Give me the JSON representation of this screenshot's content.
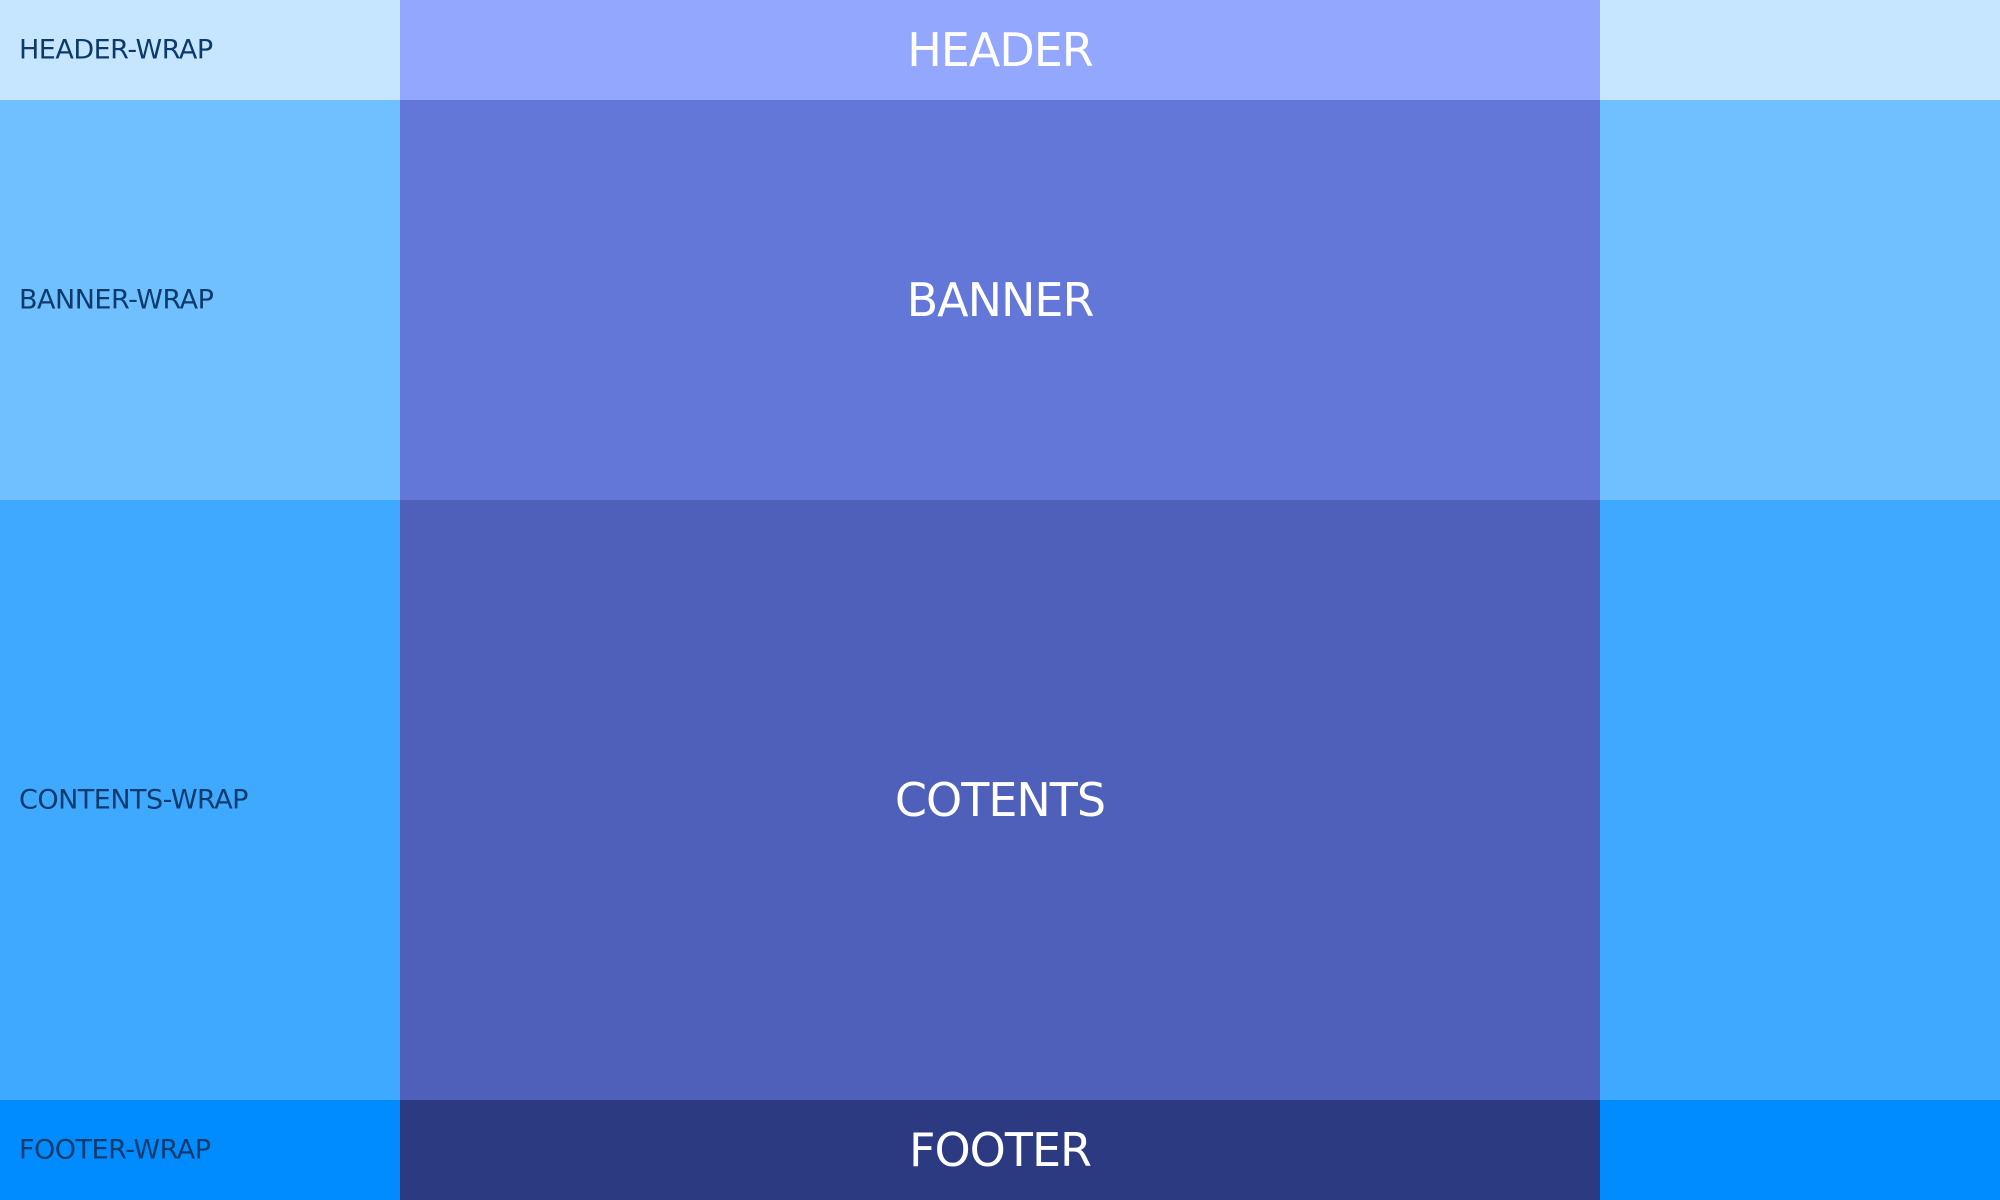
{
  "sections": {
    "header": {
      "wrap_label": "HEADER-WRAP",
      "inner_label": "HEADER",
      "wrap_color": "#c6e6ff",
      "inner_color": "#93a7ff"
    },
    "banner": {
      "wrap_label": "BANNER-WRAP",
      "inner_label": "BANNER",
      "wrap_color": "#70c0ff",
      "inner_color": "#6377d9"
    },
    "contents": {
      "wrap_label": "CONTENTS-WRAP",
      "inner_label": "COTENTS",
      "wrap_color": "#3fa9ff",
      "inner_color": "#4f60ba"
    },
    "footer": {
      "wrap_label": "FOOTER-WRAP",
      "inner_label": "FOOTER",
      "wrap_color": "#008cff",
      "inner_color": "#2c3a82"
    }
  }
}
